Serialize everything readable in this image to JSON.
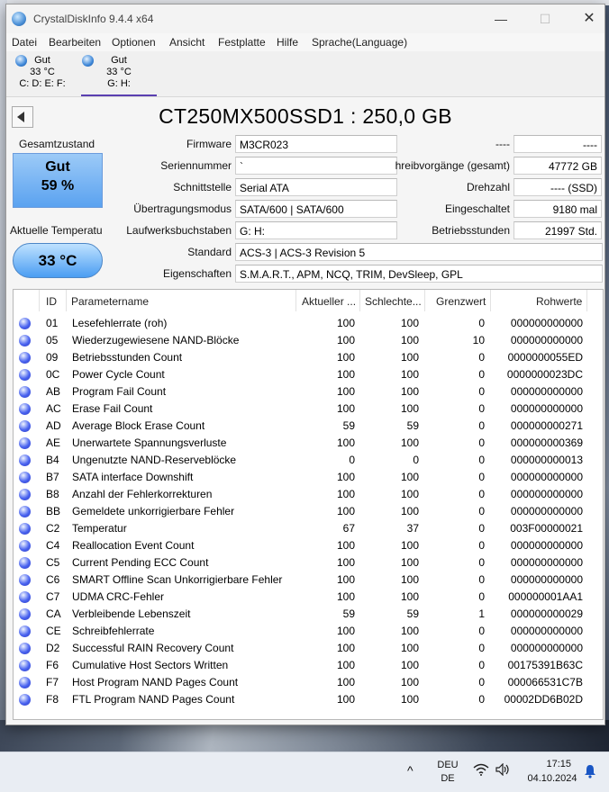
{
  "window": {
    "title": "CrystalDiskInfo 9.4.4 x64",
    "controls": {
      "minimize": "—",
      "maximize": "☐",
      "close": "✕"
    }
  },
  "menu": [
    "Datei",
    "Bearbeiten",
    "Optionen",
    "Ansicht",
    "Festplatte",
    "Hilfe",
    "Sprache(Language)"
  ],
  "drives": [
    {
      "status": "Gut",
      "temp": "33 °C",
      "letters": "C: D: E: F:",
      "selected": false
    },
    {
      "status": "Gut",
      "temp": "33 °C",
      "letters": "G: H:",
      "selected": true
    }
  ],
  "model_title": "CT250MX500SSD1 : 250,0 GB",
  "health": {
    "label": "Gesamtzustand",
    "status": "Gut",
    "percent": "59 %",
    "color": "#5aa2f0"
  },
  "temperature": {
    "label": "Aktuelle Temperatu",
    "value": "33 °C"
  },
  "info": {
    "firmware_label": "Firmware",
    "firmware": "M3CR023",
    "serial_label": "Seriennummer",
    "serial": "`",
    "interface_label": "Schnittstelle",
    "interface": "Serial ATA",
    "transfer_label": "Übertragungsmodus",
    "transfer": "SATA/600 | SATA/600",
    "letters_label": "Laufwerksbuchstaben",
    "letters": "G: H:",
    "standard_label": "Standard",
    "standard": "ACS-3 | ACS-3 Revision 5",
    "features_label": "Eigenschaften",
    "features": "S.M.A.R.T., APM, NCQ, TRIM, DevSleep, GPL",
    "r1_label": "----",
    "r1_value": "----",
    "writes_label": "hreibvorgänge (gesamt)",
    "writes": "47772 GB",
    "rpm_label": "Drehzahl",
    "rpm": "---- (SSD)",
    "power_count_label": "Eingeschaltet",
    "power_count": "9180 mal",
    "power_hours_label": "Betriebsstunden",
    "power_hours": "21997 Std."
  },
  "smart": {
    "headers": [
      "ID",
      "Parametername",
      "Aktueller ...",
      "Schlechte...",
      "Grenzwert",
      "Rohwerte"
    ],
    "rows": [
      [
        "01",
        "Lesefehlerrate (roh)",
        "100",
        "100",
        "0",
        "000000000000"
      ],
      [
        "05",
        "Wiederzugewiesene NAND-Blöcke",
        "100",
        "100",
        "10",
        "000000000000"
      ],
      [
        "09",
        "Betriebsstunden Count",
        "100",
        "100",
        "0",
        "0000000055ED"
      ],
      [
        "0C",
        "Power Cycle Count",
        "100",
        "100",
        "0",
        "0000000023DC"
      ],
      [
        "AB",
        "Program Fail Count",
        "100",
        "100",
        "0",
        "000000000000"
      ],
      [
        "AC",
        "Erase Fail Count",
        "100",
        "100",
        "0",
        "000000000000"
      ],
      [
        "AD",
        "Average Block Erase Count",
        "59",
        "59",
        "0",
        "000000000271"
      ],
      [
        "AE",
        "Unerwartete Spannungsverluste",
        "100",
        "100",
        "0",
        "000000000369"
      ],
      [
        "B4",
        "Ungenutzte NAND-Reserveblöcke",
        "0",
        "0",
        "0",
        "000000000013"
      ],
      [
        "B7",
        "SATA interface Downshift",
        "100",
        "100",
        "0",
        "000000000000"
      ],
      [
        "B8",
        "Anzahl der Fehlerkorrekturen",
        "100",
        "100",
        "0",
        "000000000000"
      ],
      [
        "BB",
        "Gemeldete unkorrigierbare Fehler",
        "100",
        "100",
        "0",
        "000000000000"
      ],
      [
        "C2",
        "Temperatur",
        "67",
        "37",
        "0",
        "003F00000021"
      ],
      [
        "C4",
        "Reallocation Event Count",
        "100",
        "100",
        "0",
        "000000000000"
      ],
      [
        "C5",
        "Current Pending ECC Count",
        "100",
        "100",
        "0",
        "000000000000"
      ],
      [
        "C6",
        "SMART Offline Scan Unkorrigierbare Fehler",
        "100",
        "100",
        "0",
        "000000000000"
      ],
      [
        "C7",
        "UDMA CRC-Fehler",
        "100",
        "100",
        "0",
        "000000001AA1"
      ],
      [
        "CA",
        "Verbleibende Lebenszeit",
        "59",
        "59",
        "1",
        "000000000029"
      ],
      [
        "CE",
        "Schreibfehlerrate",
        "100",
        "100",
        "0",
        "000000000000"
      ],
      [
        "D2",
        "Successful RAIN Recovery Count",
        "100",
        "100",
        "0",
        "000000000000"
      ],
      [
        "F6",
        "Cumulative Host Sectors Written",
        "100",
        "100",
        "0",
        "00175391B63C"
      ],
      [
        "F7",
        "Host Program NAND Pages Count",
        "100",
        "100",
        "0",
        "000066531C7B"
      ],
      [
        "F8",
        "FTL Program NAND Pages Count",
        "100",
        "100",
        "0",
        "00002DD6B02D"
      ]
    ]
  },
  "taskbar": {
    "chevron": "^",
    "lang_top": "DEU",
    "lang_bottom": "DE",
    "time": "17:15",
    "date": "04.10.2024",
    "icons": [
      "wifi-icon",
      "speaker-icon",
      "notification-bell-icon"
    ]
  }
}
